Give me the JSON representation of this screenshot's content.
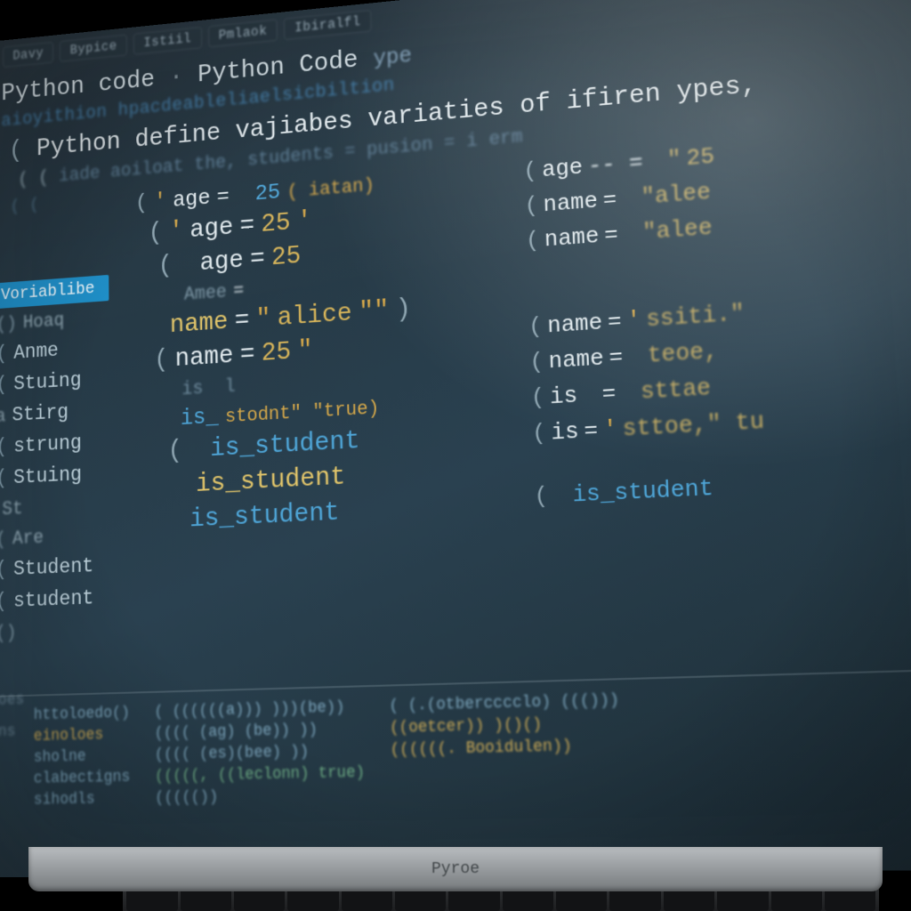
{
  "toolbar": {
    "tabs": [
      "Davy",
      "Bypice",
      "Istiil",
      "Pmlaok",
      "Ibiralfl"
    ]
  },
  "title": {
    "part1": "Python code",
    "sep": "·",
    "part2": "Python Code",
    "suffix": "ype"
  },
  "blur_line1": "aioyithion hpacdeableliaelsicbiltion",
  "heading": {
    "main": "Python define vajiabes variaties of ifiren ypes,",
    "sub": "iade aoiloat the, students = pusion = i erm"
  },
  "sidebar": {
    "header": "Voriablibe",
    "items": [
      "Hoaq",
      "Anme",
      "Stuing",
      "Stirg",
      "strung",
      "Stuing",
      "St",
      "Are",
      "Student",
      "student"
    ]
  },
  "micro_left": [
    "hioes",
    "aons"
  ],
  "code": {
    "l1": {
      "lp": "(",
      "q": "'",
      "var": "age",
      "op": "=",
      "val": "25",
      "trail": "( iatan)"
    },
    "l2": {
      "lp": "(",
      "q": "'",
      "var": "age",
      "op": "=",
      "val1": "25",
      "q2": "'"
    },
    "l3": {
      "lp": "(",
      "var": "age",
      "op": "=",
      "val": "25"
    },
    "l4": {
      "var_blur": "Amee",
      "op": "="
    },
    "l5": {
      "var": "name",
      "op": "=",
      "q": "\"",
      "str": "alice",
      "q2": "\"\"",
      "rp": ")"
    },
    "l6": {
      "lp": "(",
      "var": "name",
      "op": "=",
      "val": "25",
      "q": "\""
    },
    "l7a": {
      "var": "is_",
      "trail": "stodnt\" \"true)"
    },
    "l7b": {
      "lp": "(",
      "var": "is_student"
    },
    "l8": {
      "var": "is_student"
    },
    "l9": {
      "var": "is_student"
    }
  },
  "right": {
    "r1": {
      "lp": "(",
      "var": "age",
      "dash": "-- =",
      "q": "\"",
      "val": "25"
    },
    "r2": {
      "lp": "(",
      "var": "name",
      "op": "=",
      "val": "\"alee"
    },
    "r3": {
      "lp": "(",
      "var": "name",
      "op": "=",
      "val": "\"alee"
    },
    "r4": {
      "lp": "(",
      "var": "name",
      "op": "=",
      "q": "'",
      "val": "ssiti.\""
    },
    "r5": {
      "lp": "(",
      "var": "name",
      "op": "=",
      "val": "teoe,"
    },
    "r6": {
      "lp": "(",
      "var": "is",
      "op": "=",
      "val": "sttae"
    },
    "r7": {
      "lp": "(",
      "var": "is",
      "op": " =",
      "q": "'",
      "val": "sttoe,\" tu"
    },
    "r8": {
      "lp": "(",
      "var": "is_student"
    }
  },
  "bottom": {
    "colA": [
      "httoloedo()",
      "einoloes",
      "sholne",
      "clabectigns",
      "sihodls"
    ],
    "colB": [
      "( ((((((a))) )))(be))",
      "(((( (ag) (be)) ))",
      "(((( (es)(bee) ))",
      "(((((, ((leclonn) true)",
      "((((())"
    ],
    "colC": [
      "( (.(otbercccclo) ((()))",
      "((oetcer)) )()()",
      "((((((. Booidulen))",
      ""
    ]
  },
  "brand": "Pyroe"
}
